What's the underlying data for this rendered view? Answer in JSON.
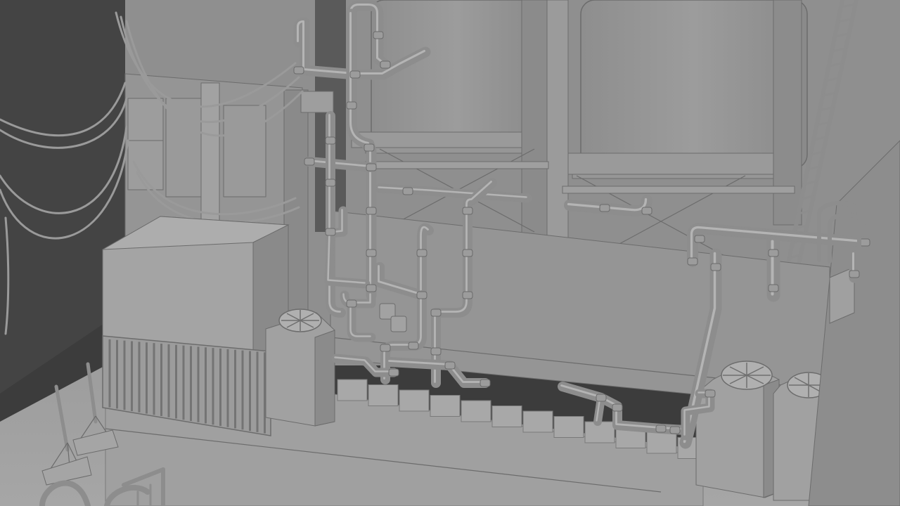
{
  "scene": {
    "kind": "3d-viewport-clay-render",
    "subject": "industrial-rooftop-utility-area",
    "colors": {
      "background_dark": "#3c3c3c",
      "wall": "#8f8f8f",
      "surface_light": "#a3a3a3",
      "surface_mid": "#959595",
      "shadow": "#7a7a7a",
      "pipe": "#8d8d8d",
      "edge": "#6c6c6c"
    },
    "icons": [
      "fan-icon"
    ]
  }
}
